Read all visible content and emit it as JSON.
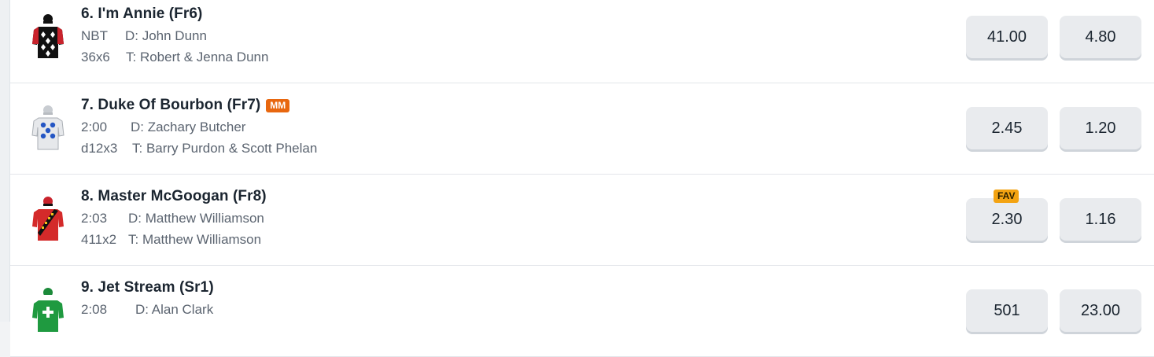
{
  "runners": [
    {
      "name": "6. I'm Annie (Fr6)",
      "badge": "",
      "last_start": "NBT",
      "driver": "D: John Dunn",
      "form": "36x6",
      "trainer": "T: Robert & Jenna Dunn",
      "win_odds": "41.00",
      "place_odds": "4.80",
      "fav": "",
      "silk": "black-white-diamonds-red-sleeves"
    },
    {
      "name": "7. Duke Of Bourbon (Fr7)",
      "badge": "MM",
      "last_start": "2:00",
      "driver": "D: Zachary Butcher",
      "form": "d12x3",
      "trainer": "T: Barry Purdon & Scott Phelan",
      "win_odds": "2.45",
      "place_odds": "1.20",
      "fav": "",
      "silk": "grey-blue-spots"
    },
    {
      "name": "8. Master McGoogan (Fr8)",
      "badge": "",
      "last_start": "2:03",
      "driver": "D: Matthew Williamson",
      "form": "411x2",
      "trainer": "T: Matthew Williamson",
      "win_odds": "2.30",
      "place_odds": "1.16",
      "fav": "FAV",
      "silk": "red-black-yellow-sash"
    },
    {
      "name": "9. Jet Stream (Sr1)",
      "badge": "",
      "last_start": "2:08",
      "driver": "D: Alan Clark",
      "form": "",
      "trainer": "",
      "win_odds": "501",
      "place_odds": "23.00",
      "fav": "",
      "silk": "green-white-cross"
    }
  ],
  "colors": {
    "mm_badge": "#e8670f",
    "fav_badge": "#f3a312",
    "odds_button": "#e9ebee"
  }
}
